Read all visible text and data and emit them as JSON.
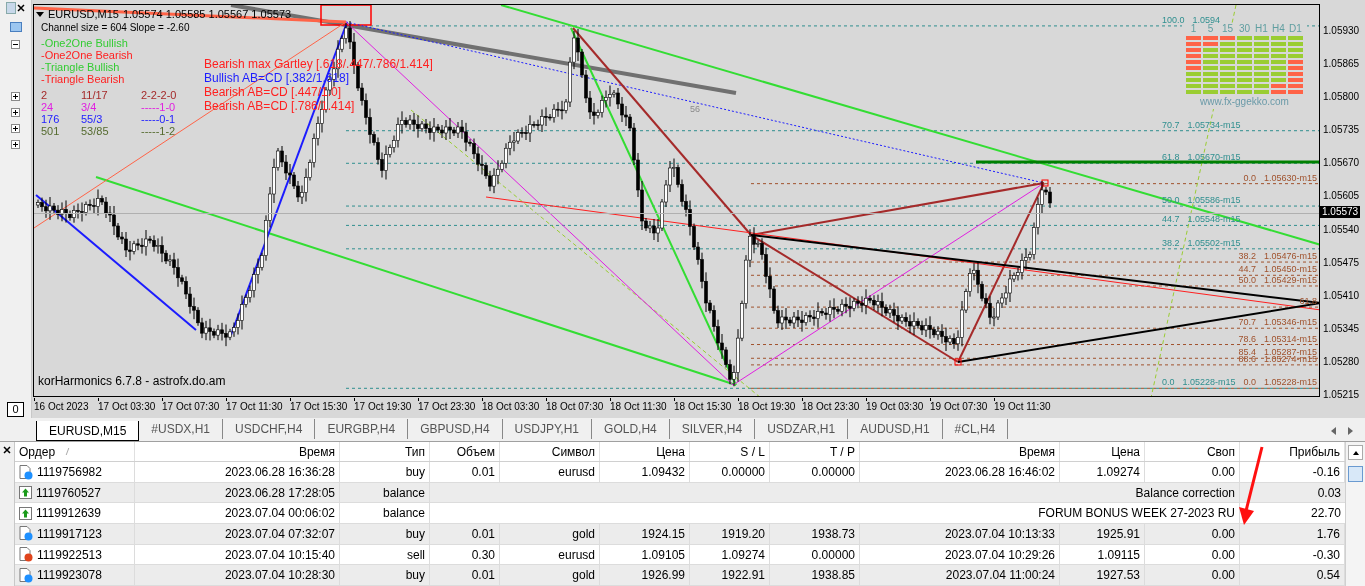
{
  "chart": {
    "title": "EURUSD,M15",
    "ohlc": "1.05574 1.05585 1.05567 1.05573",
    "channel_info": "Channel size = 604 Slope = -2.60",
    "indicator_label": "korHarmonics 6.7.8 - astrofx.do.am",
    "mark_label": "56"
  },
  "legend": [
    {
      "label": "-One2One Bullish",
      "color": "#33cc33"
    },
    {
      "label": "-One2One Bearish",
      "color": "#ff2020"
    },
    {
      "label": "-Triangle Bullish",
      "color": "#33cc33"
    },
    {
      "label": "-Triangle Bearish",
      "color": "#ff2020"
    }
  ],
  "stats": [
    {
      "count": "2",
      "ratio": "11/17",
      "code": "2-2-2-0",
      "color": "#a52a2a"
    },
    {
      "count": "24",
      "ratio": "3/4",
      "code": "-----1-0",
      "color": "#e020e0"
    },
    {
      "count": "176",
      "ratio": "55/3",
      "code": "-----0-1",
      "color": "#1c1cff"
    },
    {
      "count": "501",
      "ratio": "53/85",
      "code": "-----1-2",
      "color": "#556b2f"
    }
  ],
  "patterns": [
    {
      "label": "Bearish max Gartley [.618/.447/.786/1.414]",
      "color": "#ff2020"
    },
    {
      "label": "Bullish AB=CD [.382/1.618]",
      "color": "#1c1cff"
    },
    {
      "label": "Bearish AB=CD [.447/1.0]",
      "color": "#ff2020"
    },
    {
      "label": "Bearish AB=CD [.786/1.414]",
      "color": "#ff2020"
    }
  ],
  "fib_teal": [
    {
      "ratio": "100.0",
      "price": "1.0594"
    },
    {
      "ratio": "70.7",
      "price": "1.05734-m15"
    },
    {
      "ratio": "61.8",
      "price": "1.05670-m15"
    },
    {
      "ratio": "50.0",
      "price": "1.05586-m15"
    },
    {
      "ratio": "44.7",
      "price": "1.05548-m15"
    },
    {
      "ratio": "38.2",
      "price": "1.05502-m15"
    },
    {
      "ratio": "0.0",
      "price": "1.05228-m15"
    }
  ],
  "fib_brown": [
    {
      "ratio": "0.0",
      "price": "1.05630-m15"
    },
    {
      "ratio": "38.2",
      "price": "1.05476-m15"
    },
    {
      "ratio": "44.7",
      "price": "1.05450-m15"
    },
    {
      "ratio": "50.0",
      "price": "1.05429-m15"
    },
    {
      "ratio": "61.8"
    },
    {
      "ratio": "70.7",
      "price": "1.05346-m15"
    },
    {
      "ratio": "78.6",
      "price": "1.05314-m15"
    },
    {
      "ratio": "85.4",
      "price": "1.05287-m15"
    },
    {
      "ratio": "88.6",
      "price": "1.05274-m15"
    },
    {
      "ratio": "0.0",
      "price": "1.05228-m15"
    }
  ],
  "widget": {
    "url": "www.fx-ggekko.com",
    "timeframes": [
      {
        "label": "1",
        "cells": [
          {
            "color": "#ff6347"
          },
          {
            "color": "#ff6347"
          },
          {
            "color": "#ff6347"
          },
          {
            "color": "#ff6347"
          },
          {
            "color": "#ff6347"
          },
          {
            "color": "#ff6347"
          },
          {
            "color": "#9acd32"
          },
          {
            "color": "#9acd32"
          },
          {
            "color": "#9acd32"
          },
          {
            "color": "#9acd32"
          }
        ]
      },
      {
        "label": "5",
        "cells": [
          {
            "color": "#ff6347"
          },
          {
            "color": "#ff6347"
          },
          {
            "color": "#9acd32"
          },
          {
            "color": "#9acd32"
          },
          {
            "color": "#9acd32"
          },
          {
            "color": "#9acd32"
          },
          {
            "color": "#9acd32"
          },
          {
            "color": "#9acd32"
          },
          {
            "color": "#9acd32"
          },
          {
            "color": "#9acd32"
          }
        ]
      },
      {
        "label": "15",
        "cells": [
          {
            "color": "#ff6347"
          },
          {
            "color": "#9acd32"
          },
          {
            "color": "#9acd32"
          },
          {
            "color": "#9acd32"
          },
          {
            "color": "#9acd32"
          },
          {
            "color": "#9acd32"
          },
          {
            "color": "#9acd32"
          },
          {
            "color": "#9acd32"
          },
          {
            "color": "#9acd32"
          },
          {
            "color": "#9acd32"
          }
        ]
      },
      {
        "label": "30",
        "cells": [
          {
            "color": "#9acd32"
          },
          {
            "color": "#9acd32"
          },
          {
            "color": "#9acd32"
          },
          {
            "color": "#9acd32"
          },
          {
            "color": "#9acd32"
          },
          {
            "color": "#9acd32"
          },
          {
            "color": "#9acd32"
          },
          {
            "color": "#9acd32"
          },
          {
            "color": "#9acd32"
          },
          {
            "color": "#9acd32"
          }
        ]
      },
      {
        "label": "H1",
        "cells": [
          {
            "color": "#9acd32"
          },
          {
            "color": "#9acd32"
          },
          {
            "color": "#9acd32"
          },
          {
            "color": "#9acd32"
          },
          {
            "color": "#9acd32"
          },
          {
            "color": "#9acd32"
          },
          {
            "color": "#9acd32"
          },
          {
            "color": "#9acd32"
          },
          {
            "color": "#9acd32"
          },
          {
            "color": "#9acd32"
          }
        ]
      },
      {
        "label": "H4",
        "cells": [
          {
            "color": "#9acd32"
          },
          {
            "color": "#9acd32"
          },
          {
            "color": "#9acd32"
          },
          {
            "color": "#9acd32"
          },
          {
            "color": "#9acd32"
          },
          {
            "color": "#9acd32"
          },
          {
            "color": "#9acd32"
          },
          {
            "color": "#9acd32"
          },
          {
            "color": "#ff6347"
          },
          {
            "color": "#ff6347"
          }
        ]
      },
      {
        "label": "D1",
        "cells": [
          {
            "color": "#9acd32"
          },
          {
            "color": "#9acd32"
          },
          {
            "color": "#9acd32"
          },
          {
            "color": "#9acd32"
          },
          {
            "color": "#ff6347"
          },
          {
            "color": "#ff6347"
          },
          {
            "color": "#ff6347"
          },
          {
            "color": "#ff6347"
          },
          {
            "color": "#ff6347"
          },
          {
            "color": "#ff6347"
          }
        ]
      }
    ]
  },
  "price_axis": {
    "labels": [
      "1.05930",
      "1.05865",
      "1.05800",
      "1.05735",
      "1.05670",
      "1.05605",
      "1.05540",
      "1.05475",
      "1.05410",
      "1.05345",
      "1.05280",
      "1.05215"
    ],
    "current": "1.05573"
  },
  "time_axis": [
    "16 Oct 2023",
    "17 Oct 03:30",
    "17 Oct 07:30",
    "17 Oct 11:30",
    "17 Oct 15:30",
    "17 Oct 19:30",
    "17 Oct 23:30",
    "18 Oct 03:30",
    "18 Oct 07:30",
    "18 Oct 11:30",
    "18 Oct 15:30",
    "18 Oct 19:30",
    "18 Oct 23:30",
    "19 Oct 03:30",
    "19 Oct 07:30",
    "19 Oct 11:30"
  ],
  "navigator": {
    "count": "0"
  },
  "tabs": [
    {
      "label": "EURUSD,M15",
      "selected": true
    },
    {
      "label": "#USDX,H1",
      "selected": false
    },
    {
      "label": "USDCHF,H4",
      "selected": false
    },
    {
      "label": "EURGBP,H4",
      "selected": false
    },
    {
      "label": "GBPUSD,H4",
      "selected": false
    },
    {
      "label": "USDJPY,H1",
      "selected": false
    },
    {
      "label": "GOLD,H4",
      "selected": false
    },
    {
      "label": "SILVER,H4",
      "selected": false
    },
    {
      "label": "USDZAR,H1",
      "selected": false
    },
    {
      "label": "AUDUSD,H1",
      "selected": false
    },
    {
      "label": "#CL,H4",
      "selected": false
    }
  ],
  "table": {
    "columns": [
      "Ордер",
      "Время",
      "Тип",
      "Объем",
      "Символ",
      "Цена",
      "S / L",
      "T / P",
      "Время",
      "Цена",
      "Своп",
      "Прибыль"
    ],
    "rows": [
      {
        "kind": "trade",
        "color": "#1e90ff",
        "cells": [
          "1119756982",
          "2023.06.28 16:36:28",
          "buy",
          "0.01",
          "eurusd",
          "1.09432",
          "0.00000",
          "0.00000",
          "2023.06.28 16:46:02",
          "1.09274",
          "0.00",
          "-0.16"
        ]
      },
      {
        "kind": "balance",
        "cells": [
          "1119760527",
          "2023.06.28 17:28:05",
          "balance"
        ],
        "comment": "Balance correction",
        "profit": "0.03"
      },
      {
        "kind": "balance",
        "cells": [
          "1119912639",
          "2023.07.04 00:06:02",
          "balance"
        ],
        "comment": "FORUM BONUS WEEK 27-2023 RU",
        "profit": "22.70"
      },
      {
        "kind": "trade",
        "color": "#1e90ff",
        "cells": [
          "1119917123",
          "2023.07.04 07:32:07",
          "buy",
          "0.01",
          "gold",
          "1924.15",
          "1919.20",
          "1938.73",
          "2023.07.04 10:13:33",
          "1925.91",
          "0.00",
          "1.76"
        ]
      },
      {
        "kind": "trade",
        "color": "#e0441c",
        "cells": [
          "1119922513",
          "2023.07.04 10:15:40",
          "sell",
          "0.30",
          "eurusd",
          "1.09105",
          "1.09274",
          "0.00000",
          "2023.07.04 10:29:26",
          "1.09115",
          "0.00",
          "-0.30"
        ]
      },
      {
        "kind": "trade",
        "color": "#1e90ff",
        "cells": [
          "1119923078",
          "2023.07.04 10:28:30",
          "buy",
          "0.01",
          "gold",
          "1926.99",
          "1922.91",
          "1938.85",
          "2023.07.04 11:00:24",
          "1927.53",
          "0.00",
          "0.54"
        ]
      }
    ]
  }
}
